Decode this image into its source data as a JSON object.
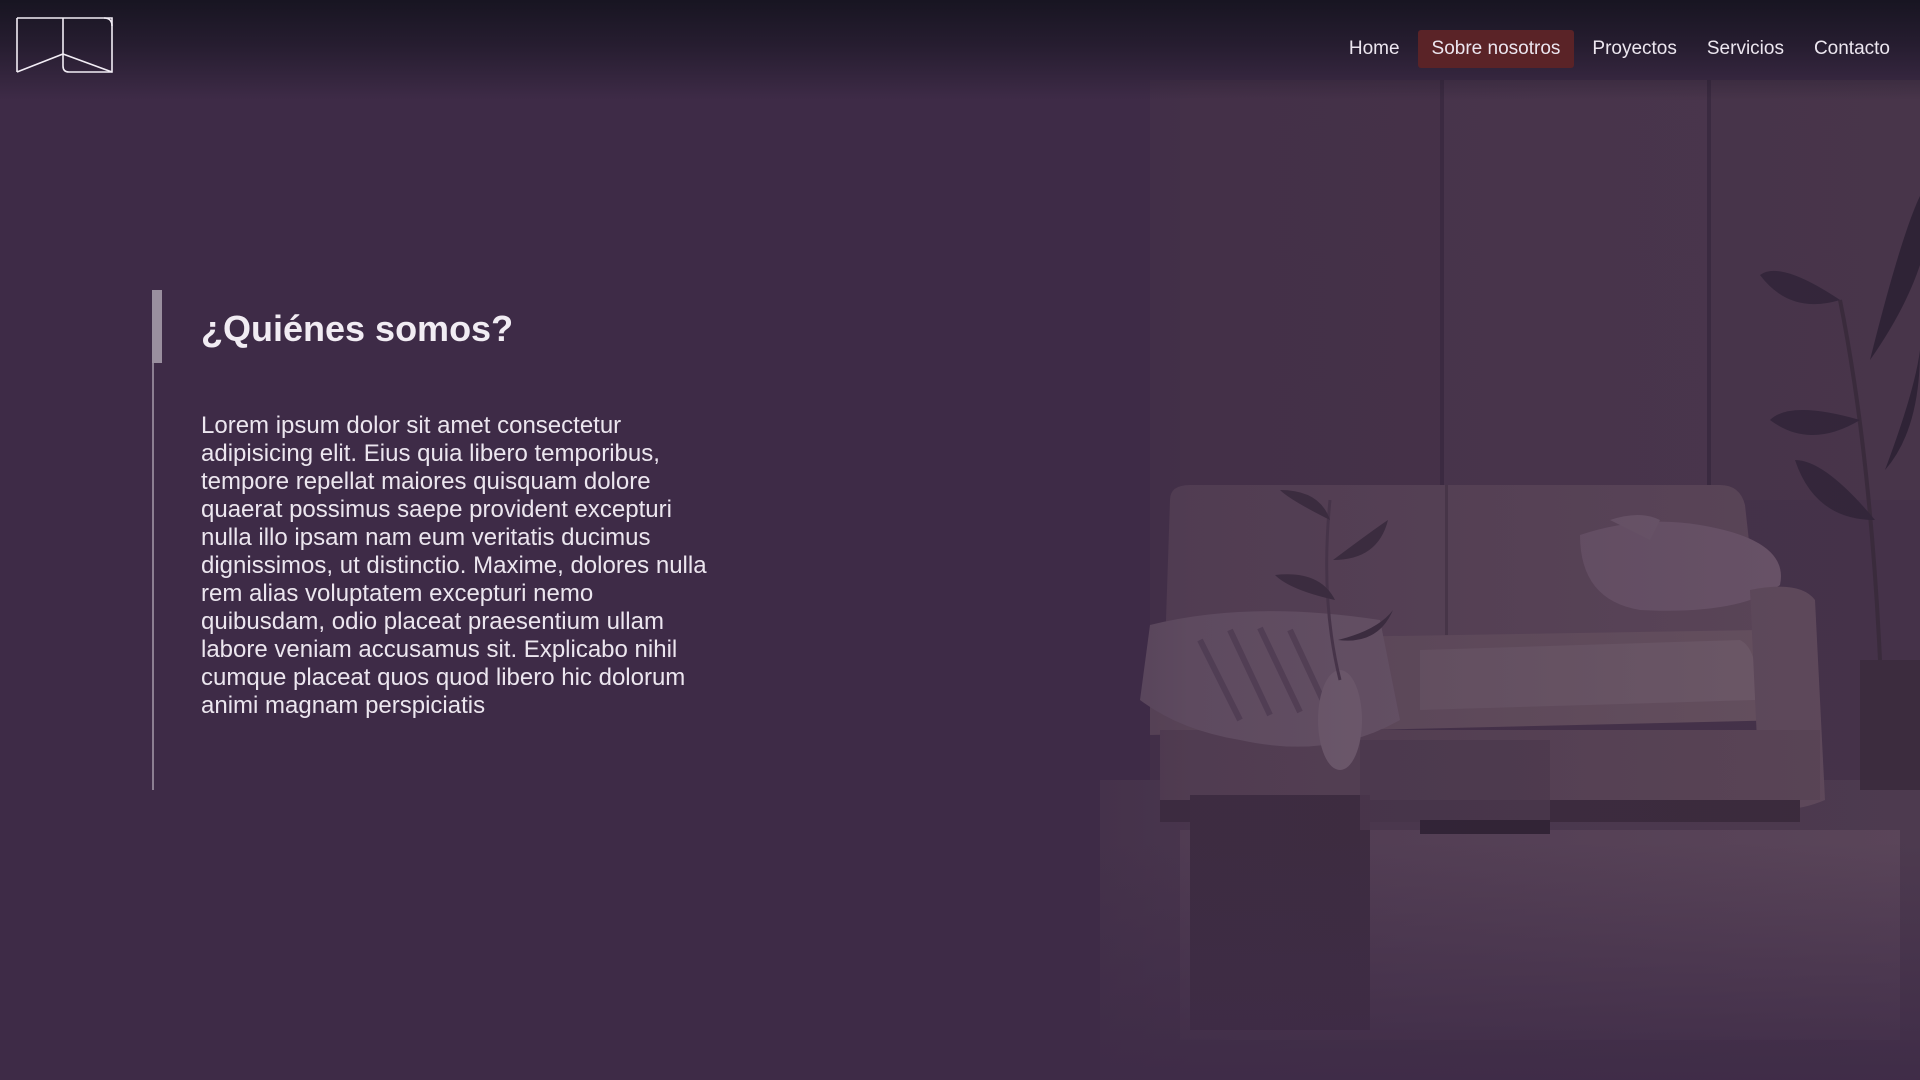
{
  "header": {
    "logo_icon": "room-outline-logo-icon",
    "nav": [
      {
        "label": "Home",
        "active": false
      },
      {
        "label": "Sobre nosotros",
        "active": true
      },
      {
        "label": "Proyectos",
        "active": false
      },
      {
        "label": "Servicios",
        "active": false
      },
      {
        "label": "Contacto",
        "active": false
      }
    ]
  },
  "about": {
    "title": "¿Quiénes somos?",
    "body": "Lorem ipsum dolor sit amet consectetur adipisicing elit. Eius quia libero temporibus, tempore repellat maiores quisquam dolore quaerat possimus saepe provident excepturi nulla illo ipsam nam eum veritatis ducimus dignissimos, ut distinctio. Maxime, dolores nulla rem alias voluptatem excepturi nemo quibusdam, odio placeat praesentium ullam labore veniam accusamus sit. Explicabo nihil cumque placeat quos quod libero hic dolorum animi magnam perspiciatis"
  },
  "colors": {
    "background": "#3e2b47",
    "nav_active": "#5a2327",
    "text": "#ece6ef"
  }
}
